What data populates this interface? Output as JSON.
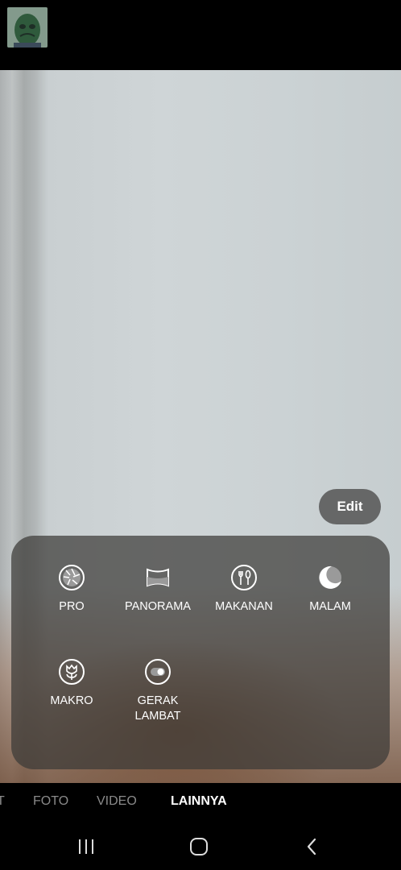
{
  "edit_button": {
    "label": "Edit"
  },
  "modes": [
    {
      "label": "PRO",
      "icon": "aperture-icon"
    },
    {
      "label": "PANORAMA",
      "icon": "panorama-icon"
    },
    {
      "label": "MAKANAN",
      "icon": "food-icon"
    },
    {
      "label": "MALAM",
      "icon": "moon-icon"
    },
    {
      "label": "MAKRO",
      "icon": "flower-icon"
    },
    {
      "label": "GERAK LAMBAT",
      "icon": "slow-motion-icon"
    }
  ],
  "tabs": [
    {
      "label": "T",
      "active": false
    },
    {
      "label": "FOTO",
      "active": false
    },
    {
      "label": "VIDEO",
      "active": false
    },
    {
      "label": "LAINNYA",
      "active": true
    }
  ],
  "navbar": {
    "buttons": [
      "recent-apps-icon",
      "home-icon",
      "back-icon"
    ]
  }
}
